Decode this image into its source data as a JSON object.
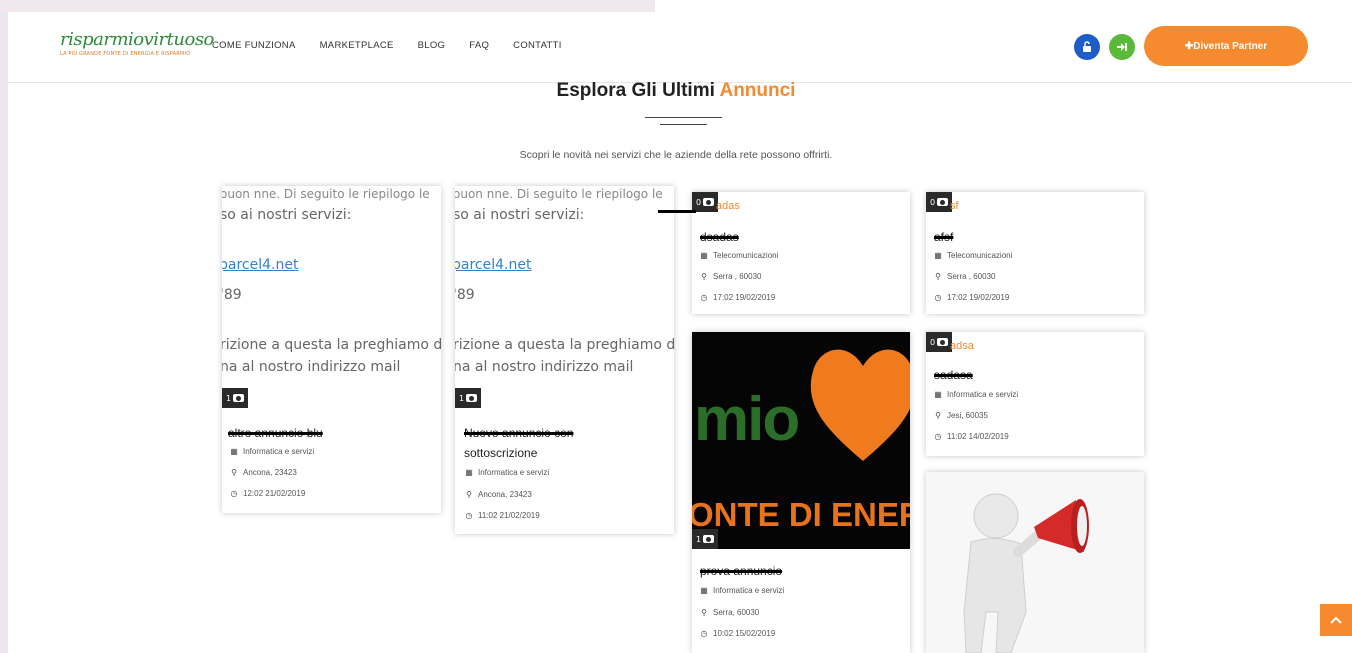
{
  "header": {
    "logo": {
      "brand": "risparmiovirtuoso",
      "tagline": "LA PIÙ GRANDE FONTE DI ENERGIA E RISPARMIO"
    },
    "nav": [
      "COME FUNZIONA",
      "MARKETPLACE",
      "BLOG",
      "FAQ",
      "CONTATTI"
    ],
    "partner_button": "✚Diventa Partner",
    "icons": {
      "lock": "unlock-icon",
      "login": "sign-in-icon"
    },
    "colors": {
      "accent": "#f58a2f",
      "lock_btn": "#1e5cc8",
      "login_btn": "#5ab83a"
    }
  },
  "section": {
    "title_main": "Esplora Gli Ultimi ",
    "title_accent": "Annunci",
    "subtitle": "Scopri le novità nei servizi che le aziende della rete possono offrirti."
  },
  "cards": [
    {
      "image_text": [
        "ouon nne. Di seguito le riepilogo le",
        "so ai nostri servizi:",
        "parcel4.net",
        "'89",
        "rizione a questa la preghiamo di",
        "na al nostro indirizzo mail"
      ],
      "photo_count": "1",
      "title": "altro annuncio blu",
      "category": "Informatica e servizi",
      "location": "Ancona, 23423",
      "date": "12:02 21/02/2019"
    },
    {
      "image_text": [
        "ouon nne. Di seguito le riepilogo le",
        "so ai nostri servizi:",
        "parcel4.net",
        "'89",
        "rizione a questa la preghiamo di",
        "na al nostro indirizzo mail"
      ],
      "photo_count": "1",
      "title": "Nuovo annuncio con",
      "title_line2": "sottoscrizione",
      "category": "Informatica e servizi",
      "location": "Ancona, 23423",
      "date": "11:02 21/02/2019"
    },
    {
      "photo_count": "0",
      "label": "adas",
      "title": "dsadas",
      "category": "Telecomunicazioni",
      "location": "Serra , 60030",
      "date": "17:02 19/02/2019"
    },
    {
      "photo_count": "0",
      "label": "sf",
      "title": "afsf",
      "category": "Telecomunicazioni",
      "location": "Serra , 60030",
      "date": "17:02 19/02/2019"
    },
    {
      "image_text": [
        "mio",
        "ONTE DI ENER"
      ],
      "photo_count": "1",
      "title": "prova annuncio",
      "category": "Informatica e servizi",
      "location": "Serra, 60030",
      "date": "10:02 15/02/2019"
    },
    {
      "photo_count": "0",
      "label": "adsa",
      "title": "sadasa",
      "category": "Informatica e servizi",
      "location": "Jesi, 60035",
      "date": "11:02 14/02/2019"
    }
  ],
  "scroll_top_icon": "chevron-up-icon"
}
